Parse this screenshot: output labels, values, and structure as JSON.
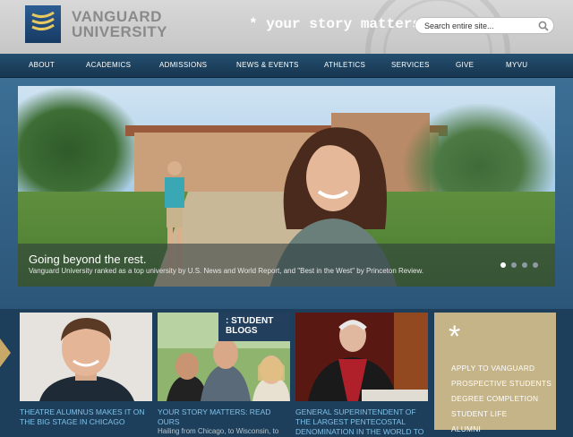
{
  "header": {
    "logo_line1": "VANGUARD",
    "logo_line2": "UNIVERSITY",
    "tagline": "* your story matters:",
    "search": {
      "placeholder": "Search entire site..."
    }
  },
  "nav": {
    "items": [
      "ABOUT",
      "ACADEMICS",
      "ADMISSIONS",
      "NEWS & EVENTS",
      "ATHLETICS",
      "SERVICES",
      "GIVE",
      "MYVU"
    ]
  },
  "hero": {
    "title": "Going beyond the rest.",
    "subtitle": "Vanguard University ranked as a top university by U.S. News and World Report, and \"Best in the West\" by Princeton Review.",
    "slide_count": 4,
    "active_slide": 1
  },
  "features": {
    "cards": [
      {
        "title": "THEATRE ALUMNUS MAKES IT ON THE BIG STAGE IN CHICAGO",
        "snippet": ""
      },
      {
        "title": "YOUR STORY MATTERS: READ OURS",
        "snippet": "Hailing from Chicago, to Wisconsin, to",
        "badge": ": STUDENT BLOGS"
      },
      {
        "title": "GENERAL SUPERINTENDENT OF THE LARGEST PENTECOSTAL DENOMINATION IN THE WORLD TO",
        "snippet": ""
      }
    ],
    "quick_links": {
      "icon": "asterisk-icon",
      "items": [
        "APPLY TO VANGUARD",
        "PROSPECTIVE STUDENTS",
        "DEGREE COMPLETION",
        "STUDENT LIFE",
        "ALUMNI"
      ]
    }
  },
  "colors": {
    "nav_bg": "#1f4663",
    "accent_tan": "#c5b488",
    "link_blue": "#7fc1e8",
    "logo_gray": "#8a8a8a"
  }
}
